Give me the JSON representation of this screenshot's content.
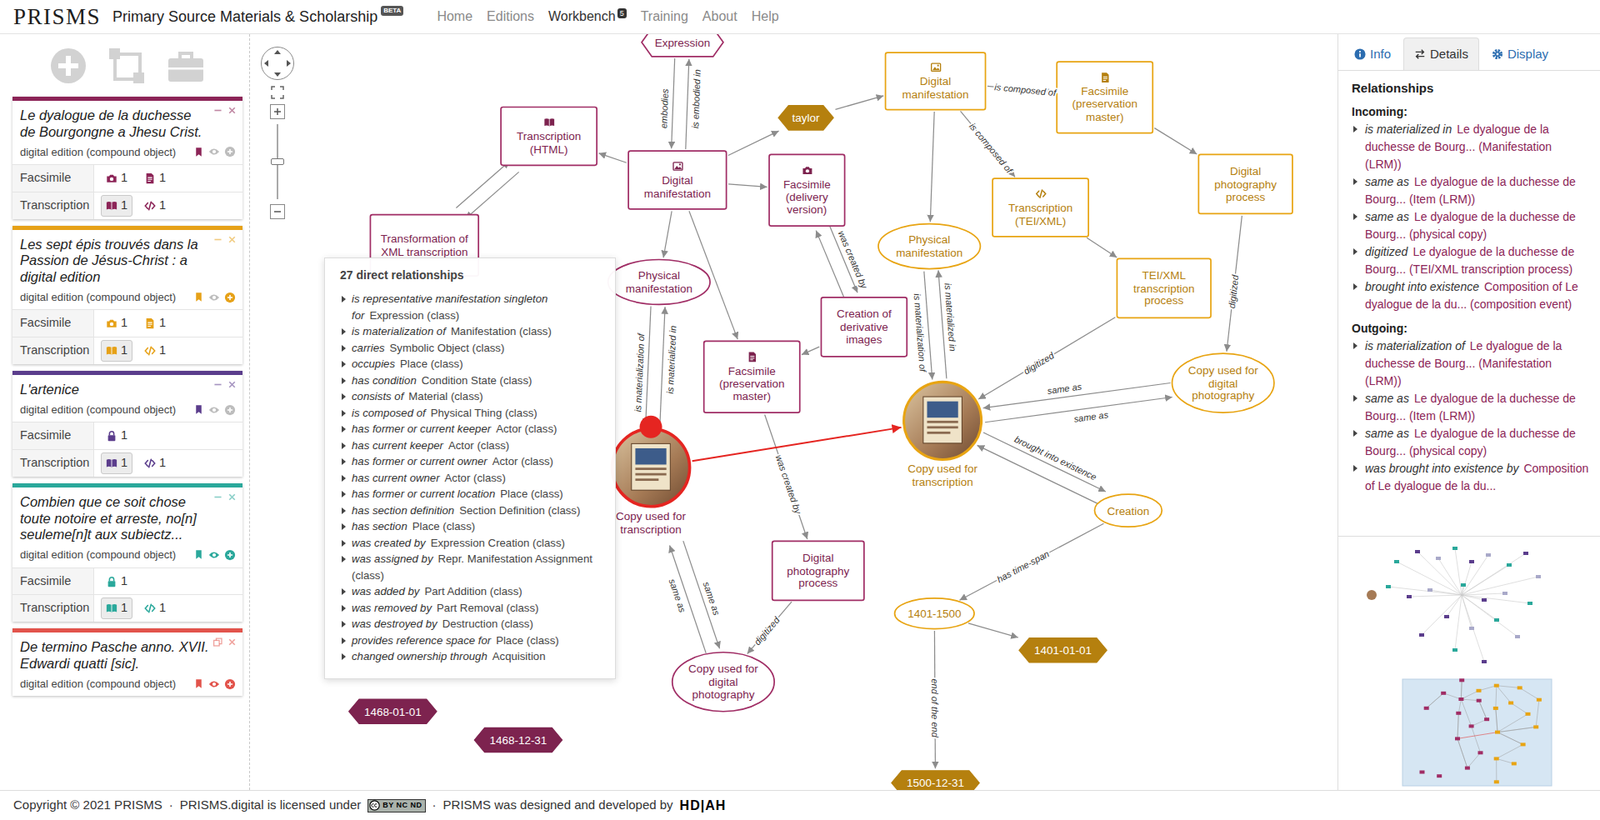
{
  "navbar": {
    "logo": "PRISMS",
    "title": "Primary Source Materials & Scholarship",
    "beta": "BETA",
    "links": [
      {
        "label": "Home",
        "selected": false
      },
      {
        "label": "Editions",
        "selected": false
      },
      {
        "label": "Workbench",
        "selected": true,
        "badge": "5"
      },
      {
        "label": "Training",
        "selected": false
      },
      {
        "label": "About",
        "selected": false
      },
      {
        "label": "Help",
        "selected": false
      }
    ]
  },
  "editions": [
    {
      "title": "Le dyalogue de la duchesse de Bourgongne a Jhesu Crist.",
      "subtitle": "digital edition (compound object)",
      "color": "#8c2457",
      "collapsed": false,
      "visible": false,
      "added": false,
      "rows": [
        {
          "label": "Facsimile",
          "items": [
            {
              "kind": "camera",
              "count": "1",
              "selected": false
            },
            {
              "kind": "document",
              "count": "1",
              "selected": false
            }
          ]
        },
        {
          "label": "Transcription",
          "items": [
            {
              "kind": "book",
              "count": "1",
              "selected": true
            },
            {
              "kind": "code",
              "count": "1",
              "selected": false
            }
          ]
        }
      ]
    },
    {
      "title": "Les sept épis trouvés dans la Passion de Jésus-Christ : a digital edition",
      "subtitle": "digital edition (compound object)",
      "color": "#e6a117",
      "collapsed": false,
      "visible": false,
      "added": true,
      "rows": [
        {
          "label": "Facsimile",
          "items": [
            {
              "kind": "camera",
              "count": "1",
              "selected": false
            },
            {
              "kind": "document",
              "count": "1",
              "selected": false
            }
          ]
        },
        {
          "label": "Transcription",
          "items": [
            {
              "kind": "book",
              "count": "1",
              "selected": true
            },
            {
              "kind": "code",
              "count": "1",
              "selected": false
            }
          ]
        }
      ]
    },
    {
      "title": "L'artenice",
      "subtitle": "digital edition (compound object)",
      "color": "#5b3d8c",
      "collapsed": false,
      "visible": false,
      "added": false,
      "rows": [
        {
          "label": "Facsimile",
          "items": [
            {
              "kind": "lock",
              "count": "1",
              "selected": false
            }
          ]
        },
        {
          "label": "Transcription",
          "items": [
            {
              "kind": "book",
              "count": "1",
              "selected": true
            },
            {
              "kind": "code",
              "count": "1",
              "selected": false
            }
          ]
        }
      ]
    },
    {
      "title": "Combien que ce soit chose toute notoire et arreste, no[n] seuleme[n]t aux subiectz...",
      "subtitle": "digital edition (compound object)",
      "color": "#2aa89b",
      "collapsed": false,
      "visible": true,
      "added": true,
      "rows": [
        {
          "label": "Facsimile",
          "items": [
            {
              "kind": "lock",
              "count": "1",
              "selected": false
            }
          ]
        },
        {
          "label": "Transcription",
          "items": [
            {
              "kind": "book",
              "count": "1",
              "selected": true
            },
            {
              "kind": "code",
              "count": "1",
              "selected": false
            }
          ]
        }
      ]
    },
    {
      "title": "De termino Pasche anno. XVII. Edwardi quatti [sic].",
      "subtitle": "digital edition (compound object)",
      "color": "#e2534b",
      "collapsed": true,
      "visible": true,
      "added": true,
      "rows": []
    }
  ],
  "canvas": {
    "zoom": {
      "level": 0.5
    },
    "nodes": [
      {
        "label": "Expression",
        "kind": "hexagon",
        "color": "#a02d65",
        "selected": false
      },
      {
        "label": "Transcription (HTML)",
        "kind": "work",
        "color": "#a02d65",
        "selected": false
      },
      {
        "label": "Digital manifestation",
        "kind": "digital",
        "color": "#a02d65",
        "selected": false
      },
      {
        "label": "Facsimile (delivery version)",
        "kind": "camera",
        "color": "#a02d65",
        "selected": false
      },
      {
        "label": "Transformation of XML transcription",
        "kind": "process",
        "color": "#a02d65",
        "selected": false
      },
      {
        "label": "Physical manifestation",
        "kind": "ellipse",
        "color": "#a02d65",
        "selected": false
      },
      {
        "label": "Facsimile (preservation master)",
        "kind": "document",
        "color": "#a02d65",
        "selected": false
      },
      {
        "label": "Creation of derivative images",
        "kind": "process",
        "color": "#a02d65",
        "selected": false
      },
      {
        "label": "Copy used for transcription",
        "kind": "photo",
        "color": "#a02d65",
        "selected": true
      },
      {
        "label": "Digital photography process",
        "kind": "process",
        "color": "#a02d65",
        "selected": false
      },
      {
        "label": "Copy used for digital photography",
        "kind": "ellipse",
        "color": "#a02d65",
        "selected": false
      },
      {
        "label": "1468-01-01",
        "kind": "diamond",
        "color": "#a02d65",
        "selected": false
      },
      {
        "label": "1468-12-31",
        "kind": "diamond",
        "color": "#a02d65",
        "selected": false
      },
      {
        "label": "Digital manifestation",
        "kind": "digital",
        "color": "#e8a412",
        "selected": false
      },
      {
        "label": "Facsimile (preservation master)",
        "kind": "document",
        "color": "#e8a412",
        "selected": false
      },
      {
        "label": "taylor",
        "kind": "diamond",
        "color": "#e8a412",
        "selected": false
      },
      {
        "label": "Digital photography process",
        "kind": "process",
        "color": "#e8a412",
        "selected": false
      },
      {
        "label": "Transcription (TEI/XML)",
        "kind": "code",
        "color": "#e8a412",
        "selected": false
      },
      {
        "label": "Physical manifestation",
        "kind": "ellipse",
        "color": "#e8a412",
        "selected": false
      },
      {
        "label": "TEI/XML transcription process",
        "kind": "process",
        "color": "#e8a412",
        "selected": false
      },
      {
        "label": "Copy used for digital photography",
        "kind": "ellipse",
        "color": "#e8a412",
        "selected": false
      },
      {
        "label": "Copy used for transcription",
        "kind": "photo",
        "color": "#e8a412",
        "selected": false
      },
      {
        "label": "Creation",
        "kind": "ellipse",
        "color": "#e8a412",
        "selected": false
      },
      {
        "label": "1401-1500",
        "kind": "ellipse",
        "color": "#e8a412",
        "selected": false
      },
      {
        "label": "1401-01-01",
        "kind": "diamond",
        "color": "#e8a412",
        "selected": false
      },
      {
        "label": "1500-12-31",
        "kind": "diamond",
        "color": "#e8a412",
        "selected": false
      }
    ],
    "edges": [
      {
        "from": 2,
        "to": 0,
        "label": "is embodied in",
        "selected": false
      },
      {
        "from": 0,
        "to": 2,
        "label": "embodies",
        "selected": false
      },
      {
        "from": 2,
        "to": 1,
        "selected": false
      },
      {
        "from": 1,
        "to": 4,
        "selected": false
      },
      {
        "from": 4,
        "to": 1,
        "selected": false
      },
      {
        "from": 2,
        "to": 5,
        "selected": false
      },
      {
        "from": 2,
        "to": 3,
        "selected": false
      },
      {
        "from": 2,
        "to": 6,
        "selected": false
      },
      {
        "from": 2,
        "to": 15,
        "selected": false
      },
      {
        "from": 15,
        "to": 13,
        "selected": false
      },
      {
        "from": 3,
        "to": 7,
        "label": "was created by",
        "selected": false
      },
      {
        "from": 7,
        "to": 3,
        "selected": false
      },
      {
        "from": 7,
        "to": 6,
        "selected": false
      },
      {
        "from": 8,
        "to": 5,
        "label": "is materialized in",
        "selected": false
      },
      {
        "from": 5,
        "to": 8,
        "label": "is materialization of",
        "selected": false
      },
      {
        "from": 6,
        "to": 9,
        "label": "was created by",
        "selected": false
      },
      {
        "from": 8,
        "to": 10,
        "label": "same as",
        "selected": false
      },
      {
        "from": 10,
        "to": 8,
        "label": "same as",
        "selected": false
      },
      {
        "from": 9,
        "to": 10,
        "label": "digitized",
        "selected": false
      },
      {
        "from": 8,
        "to": 21,
        "selected": true
      },
      {
        "from": 21,
        "to": 18,
        "label": "is materialized in",
        "selected": false
      },
      {
        "from": 18,
        "to": 21,
        "label": "is materialization of",
        "selected": false
      },
      {
        "from": 13,
        "to": 18,
        "selected": false
      },
      {
        "from": 13,
        "to": 17,
        "label": "is composed of",
        "selected": false
      },
      {
        "from": 13,
        "to": 14,
        "label": "is composed of",
        "selected": false
      },
      {
        "from": 14,
        "to": 16,
        "selected": false
      },
      {
        "from": 17,
        "to": 19,
        "selected": false
      },
      {
        "from": 19,
        "to": 21,
        "label": "digitized",
        "selected": false
      },
      {
        "from": 21,
        "to": 20,
        "label": "same as",
        "selected": false
      },
      {
        "from": 20,
        "to": 21,
        "label": "same as",
        "selected": false
      },
      {
        "from": 16,
        "to": 20,
        "label": "digitized",
        "selected": false
      },
      {
        "from": 21,
        "to": 22,
        "label": "brought into existence",
        "selected": false
      },
      {
        "from": 22,
        "to": 21,
        "selected": false
      },
      {
        "from": 22,
        "to": 23,
        "label": "has time-span",
        "selected": false
      },
      {
        "from": 23,
        "to": 24,
        "selected": false
      },
      {
        "from": 23,
        "to": 25,
        "label": "end of the end",
        "selected": false
      }
    ],
    "popup": {
      "title": "27 direct relationships",
      "items": [
        {
          "relation": "is representative manifestation singleton for",
          "target": "Expression (class)",
          "expanded": false
        },
        {
          "relation": "is materialization of",
          "target": "Manifestation (class)",
          "expanded": false
        },
        {
          "relation": "carries",
          "target": "Symbolic Object (class)",
          "expanded": false
        },
        {
          "relation": "occupies",
          "target": "Place (class)",
          "expanded": false
        },
        {
          "relation": "has condition",
          "target": "Condition State (class)",
          "expanded": false
        },
        {
          "relation": "consists of",
          "target": "Material (class)",
          "expanded": false
        },
        {
          "relation": "is composed of",
          "target": "Physical Thing (class)",
          "expanded": false
        },
        {
          "relation": "has former or current keeper",
          "target": "Actor (class)",
          "expanded": false
        },
        {
          "relation": "has current keeper",
          "target": "Actor (class)",
          "expanded": false
        },
        {
          "relation": "has former or current owner",
          "target": "Actor (class)",
          "expanded": false
        },
        {
          "relation": "has current owner",
          "target": "Actor (class)",
          "expanded": false
        },
        {
          "relation": "has former or current location",
          "target": "Place (class)",
          "expanded": false
        },
        {
          "relation": "has section definition",
          "target": "Section Definition (class)",
          "expanded": false
        },
        {
          "relation": "has section",
          "target": "Place (class)",
          "expanded": false
        },
        {
          "relation": "was created by",
          "target": "Expression Creation (class)",
          "expanded": false
        },
        {
          "relation": "was assigned by",
          "target": "Repr. Manifestation Assignment (class)",
          "expanded": false
        },
        {
          "relation": "was added by",
          "target": "Part Addition (class)",
          "expanded": false
        },
        {
          "relation": "was removed by",
          "target": "Part Removal (class)",
          "expanded": false
        },
        {
          "relation": "was destroyed by",
          "target": "Destruction (class)",
          "expanded": false
        },
        {
          "relation": "provides reference space for",
          "target": "Place (class)",
          "expanded": false
        },
        {
          "relation": "changed ownership through",
          "target": "Acquisition",
          "expanded": false
        }
      ]
    }
  },
  "panel": {
    "tabs": [
      {
        "label": "Info",
        "selected": false
      },
      {
        "label": "Details",
        "selected": true
      },
      {
        "label": "Display",
        "selected": false
      }
    ],
    "heading": "Relationships",
    "groups": [
      {
        "label": "Incoming:",
        "items": [
          {
            "relation": "is materialized in",
            "target": "Le dyalogue de la duchesse de Bourg... (Manifestation (LRM))",
            "expanded": false
          },
          {
            "relation": "same as",
            "target": "Le dyalogue de la duchesse de Bourg... (Item (LRM))",
            "expanded": false
          },
          {
            "relation": "same as",
            "target": "Le dyalogue de la duchesse de Bourg... (physical copy)",
            "expanded": false
          },
          {
            "relation": "digitized",
            "target": "Le dyalogue de la duchesse de Bourg... (TEI/XML transcription process)",
            "expanded": false
          },
          {
            "relation": "brought into existence",
            "target": "Composition of Le dyalogue de la du... (composition event)",
            "expanded": false
          }
        ]
      },
      {
        "label": "Outgoing:",
        "items": [
          {
            "relation": "is materialization of",
            "target": "Le dyalogue de la duchesse de Bourg... (Manifestation (LRM))",
            "expanded": false
          },
          {
            "relation": "same as",
            "target": "Le dyalogue de la duchesse de Bourg... (Item (LRM))",
            "expanded": false
          },
          {
            "relation": "same as",
            "target": "Le dyalogue de la duchesse de Bourg... (physical copy)",
            "expanded": false
          },
          {
            "relation": "was brought into existence by",
            "target": "Composition of Le dyalogue de la du...",
            "expanded": false
          }
        ]
      }
    ]
  },
  "footer": {
    "copyright": "Copyright © 2021 PRISMS",
    "separators": [
      "·",
      "·"
    ],
    "license": "PRISMS.digital is licensed under",
    "badge": "BY NC ND",
    "credit": "PRISMS was designed and developed by",
    "logo": "HD|AH"
  }
}
